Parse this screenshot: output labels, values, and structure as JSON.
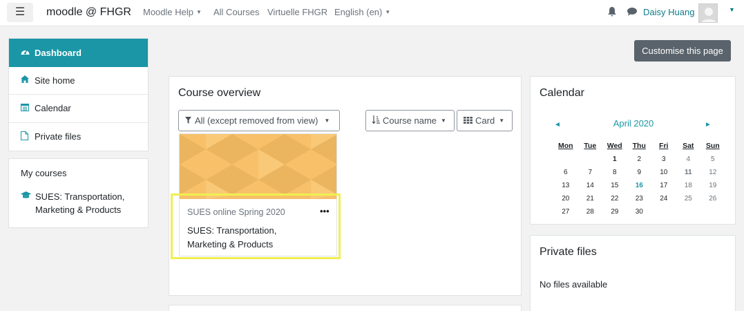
{
  "navbar": {
    "menu_icon": "hamburger-icon",
    "brand": "moodle @ FHGR",
    "menu": [
      {
        "label": "Moodle Help",
        "has_dropdown": true
      },
      {
        "label": "All Courses",
        "has_dropdown": false
      },
      {
        "label": "Virtuelle FHGR",
        "has_dropdown": false
      },
      {
        "label": "English (en)",
        "has_dropdown": true
      }
    ],
    "username": "Daisy Huang"
  },
  "sidebar": {
    "items": [
      {
        "label": "Dashboard",
        "icon": "dashboard-icon",
        "active": true
      },
      {
        "label": "Site home",
        "icon": "home-icon",
        "active": false
      },
      {
        "label": "Calendar",
        "icon": "calendar-icon",
        "active": false
      },
      {
        "label": "Private files",
        "icon": "file-icon",
        "active": false
      }
    ]
  },
  "my_courses": {
    "title": "My courses",
    "courses": [
      {
        "name": "SUES: Transportation,",
        "name_line2": "Marketing & Products",
        "icon": "graduation-cap-icon"
      }
    ]
  },
  "main": {
    "customise_label": "Customise this page",
    "course_overview": {
      "title": "Course overview",
      "filter_label": "All (except removed from view)",
      "sort_label": "Course name",
      "view_label": "Card",
      "courses": [
        {
          "category": "SUES online Spring 2020",
          "name_line1": "SUES: Transportation,",
          "name_line2": "Marketing & Products",
          "menu": "•••"
        }
      ]
    }
  },
  "calendar": {
    "title": "Calendar",
    "month": "April 2020",
    "prev": "◄",
    "next": "►",
    "weekdays": [
      "Mon",
      "Tue",
      "Wed",
      "Thu",
      "Fri",
      "Sat",
      "Sun"
    ],
    "weeks": [
      [
        "",
        "",
        "1",
        "2",
        "3",
        "4",
        "5"
      ],
      [
        "6",
        "7",
        "8",
        "9",
        "10",
        "11",
        "12"
      ],
      [
        "13",
        "14",
        "15",
        "16",
        "17",
        "18",
        "19"
      ],
      [
        "20",
        "21",
        "22",
        "23",
        "24",
        "25",
        "26"
      ],
      [
        "27",
        "28",
        "29",
        "30",
        "",
        "",
        ""
      ]
    ],
    "today": "16"
  },
  "private_files": {
    "title": "Private files",
    "empty_text": "No files available"
  },
  "colors": {
    "accent": "#1a96a6",
    "highlight": "#f0ef4f",
    "course_image": "#f7c069"
  }
}
